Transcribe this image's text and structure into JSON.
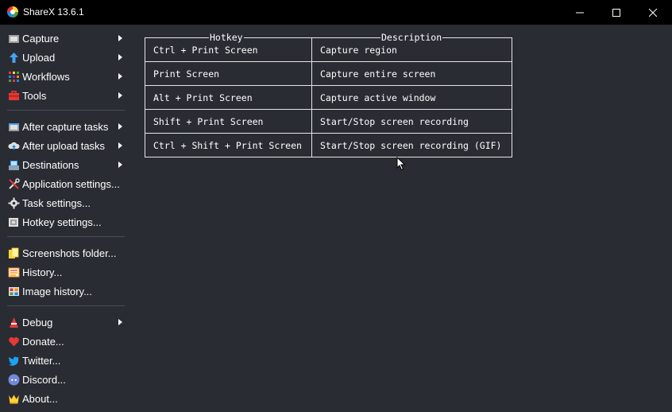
{
  "window": {
    "title": "ShareX 13.6.1"
  },
  "menu": {
    "items": [
      {
        "label": "Capture",
        "icon": "capture-icon",
        "submenu": true
      },
      {
        "label": "Upload",
        "icon": "upload-icon",
        "submenu": true
      },
      {
        "label": "Workflows",
        "icon": "workflows-icon",
        "submenu": true
      },
      {
        "label": "Tools",
        "icon": "tools-icon",
        "submenu": true
      },
      {
        "label": "After capture tasks",
        "icon": "after-capture-icon",
        "submenu": true
      },
      {
        "label": "After upload tasks",
        "icon": "after-upload-icon",
        "submenu": true
      },
      {
        "label": "Destinations",
        "icon": "destinations-icon",
        "submenu": true
      },
      {
        "label": "Application settings...",
        "icon": "app-settings-icon",
        "submenu": false
      },
      {
        "label": "Task settings...",
        "icon": "gear-icon",
        "submenu": false
      },
      {
        "label": "Hotkey settings...",
        "icon": "keyboard-icon",
        "submenu": false
      },
      {
        "label": "Screenshots folder...",
        "icon": "folder-icon",
        "submenu": false
      },
      {
        "label": "History...",
        "icon": "history-icon",
        "submenu": false
      },
      {
        "label": "Image history...",
        "icon": "image-history-icon",
        "submenu": false
      },
      {
        "label": "Debug",
        "icon": "debug-icon",
        "submenu": true
      },
      {
        "label": "Donate...",
        "icon": "heart-icon",
        "submenu": false
      },
      {
        "label": "Twitter...",
        "icon": "twitter-icon",
        "submenu": false
      },
      {
        "label": "Discord...",
        "icon": "discord-icon",
        "submenu": false
      },
      {
        "label": "About...",
        "icon": "crown-icon",
        "submenu": false
      }
    ]
  },
  "hotkeys": {
    "header_hotkey": "Hotkey",
    "header_description": "Description",
    "rows": [
      {
        "hotkey": "Ctrl + Print Screen",
        "description": "Capture region"
      },
      {
        "hotkey": "Print Screen",
        "description": "Capture entire screen"
      },
      {
        "hotkey": "Alt + Print Screen",
        "description": "Capture active window"
      },
      {
        "hotkey": "Shift + Print Screen",
        "description": "Start/Stop screen recording"
      },
      {
        "hotkey": "Ctrl + Shift + Print Screen",
        "description": "Start/Stop screen recording (GIF)"
      }
    ]
  },
  "colors": {
    "background": "#2a2c33",
    "titlebar": "#000000",
    "separator": "#4a4d55",
    "table_border": "#e6e6e6"
  }
}
